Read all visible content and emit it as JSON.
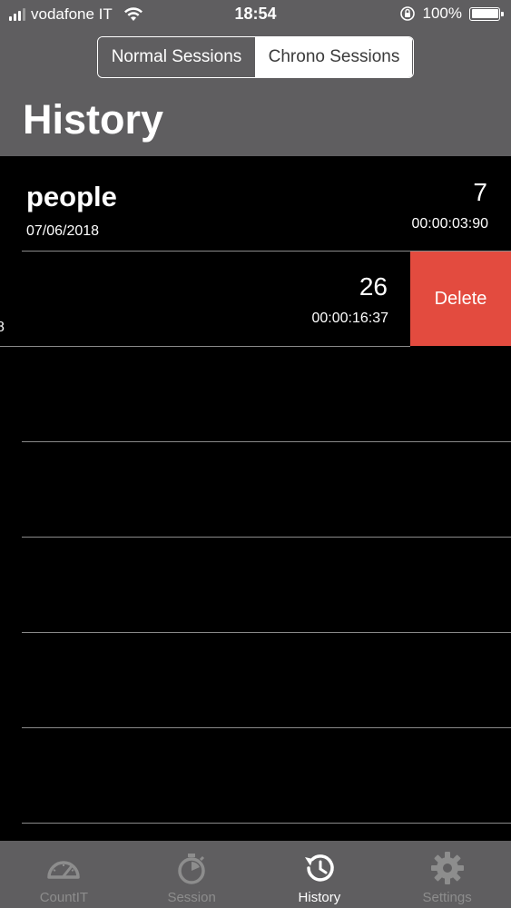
{
  "status_bar": {
    "carrier": "vodafone IT",
    "time": "18:54",
    "battery_percent": "100%"
  },
  "segmented_control": {
    "options": [
      "Normal Sessions",
      "Chrono Sessions"
    ],
    "selected": "Chrono Sessions"
  },
  "page_title": "History",
  "sessions": [
    {
      "name": "people",
      "date": "07/06/2018",
      "count": "7",
      "duration": "00:00:03:90"
    },
    {
      "name": "",
      "date": "8",
      "count": "26",
      "duration": "00:00:16:37"
    }
  ],
  "delete_label": "Delete",
  "tabbar": {
    "items": [
      {
        "label": "CountIT",
        "icon": "speedometer-icon",
        "active": false
      },
      {
        "label": "Session",
        "icon": "stopwatch-icon",
        "active": false
      },
      {
        "label": "History",
        "icon": "history-clock-icon",
        "active": true
      },
      {
        "label": "Settings",
        "icon": "gear-icon",
        "active": false
      }
    ]
  },
  "colors": {
    "header_bg": "#5f5e60",
    "list_bg": "#000000",
    "delete_bg": "#e34b3f",
    "tab_active": "#ffffff",
    "tab_inactive": "#8d8d8d"
  }
}
